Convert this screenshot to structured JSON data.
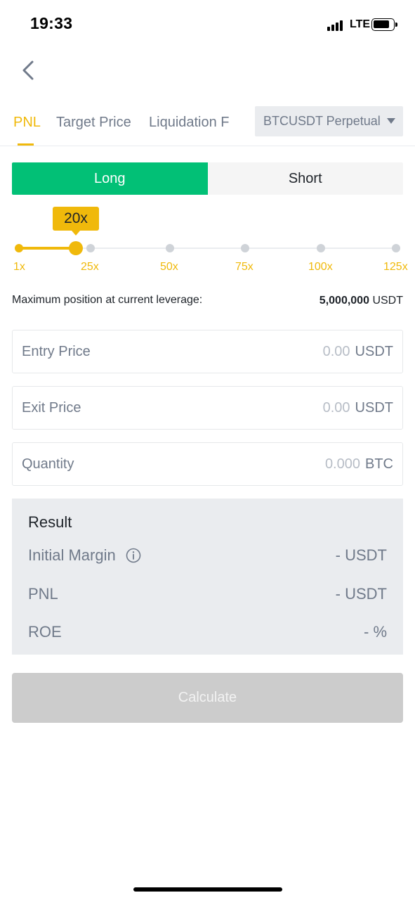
{
  "status_bar": {
    "time": "19:33",
    "network": "LTE"
  },
  "tabs": [
    {
      "label": "PNL",
      "active": true
    },
    {
      "label": "Target Price",
      "active": false
    },
    {
      "label": "Liquidation F",
      "active": false
    }
  ],
  "symbol": {
    "label": "BTCUSDT Perpetual"
  },
  "side": {
    "long_label": "Long",
    "short_label": "Short",
    "selected": "Long"
  },
  "leverage": {
    "current_label": "20x",
    "current_value": 20,
    "ticks": [
      "1x",
      "25x",
      "50x",
      "75x",
      "100x",
      "125x"
    ]
  },
  "max_position": {
    "label": "Maximum position at current leverage:",
    "value": "5,000,000",
    "unit": "USDT"
  },
  "fields": {
    "entry_price": {
      "label": "Entry Price",
      "value": "0.00",
      "unit": "USDT"
    },
    "exit_price": {
      "label": "Exit Price",
      "value": "0.00",
      "unit": "USDT"
    },
    "quantity": {
      "label": "Quantity",
      "value": "0.000",
      "unit": "BTC"
    }
  },
  "result": {
    "title": "Result",
    "initial_margin": {
      "label": "Initial Margin",
      "value": "- USDT"
    },
    "pnl": {
      "label": "PNL",
      "value": "- USDT"
    },
    "roe": {
      "label": "ROE",
      "value": "- %"
    }
  },
  "calculate_label": "Calculate",
  "colors": {
    "accent": "#f0b90b",
    "long": "#02c076",
    "disabled": "#cccccc"
  }
}
